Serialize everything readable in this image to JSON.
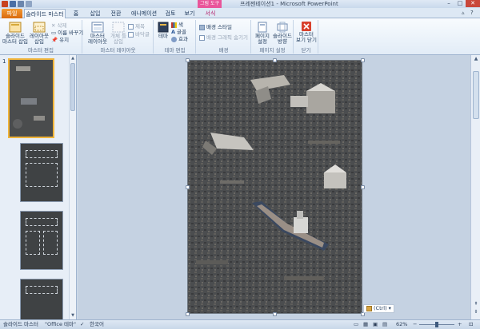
{
  "window": {
    "title": "프레젠테이션1 - Microsoft PowerPoint",
    "context_group": "그림 도구"
  },
  "tabs": [
    {
      "label": "파일",
      "kind": "file"
    },
    {
      "label": "슬라이드 마스터",
      "kind": "active"
    },
    {
      "label": "홈",
      "kind": "normal"
    },
    {
      "label": "삽입",
      "kind": "normal"
    },
    {
      "label": "전환",
      "kind": "normal"
    },
    {
      "label": "애니메이션",
      "kind": "normal"
    },
    {
      "label": "검토",
      "kind": "normal"
    },
    {
      "label": "보기",
      "kind": "normal"
    },
    {
      "label": "서식",
      "kind": "ctx"
    }
  ],
  "ribbon": {
    "master_edit": {
      "label": "마스터 편집",
      "insert_master": "슬라이드\n마스터 삽입",
      "insert_layout": "레이아웃\n삽입",
      "delete": "삭제",
      "rename": "이름 바꾸기",
      "preserve": "유지"
    },
    "master_layout": {
      "label": "마스터 레이아웃",
      "master_layout_btn": "마스터\n레이아웃",
      "insert_placeholder": "개체 틀\n삽입",
      "title": "제목",
      "footer": "바닥글"
    },
    "theme_edit": {
      "label": "테마 편집",
      "theme": "테마",
      "colors": "색",
      "fonts": "글꼴",
      "effects": "효과"
    },
    "background": {
      "label": "배경",
      "bg_styles": "배경 스타일",
      "hide_bg": "배경 그래픽 숨기기"
    },
    "page_setup": {
      "label": "페이지 설정",
      "setup": "페이지\n설정",
      "orientation": "슬라이드\n방향"
    },
    "close": {
      "label": "닫기",
      "close_master": "마스터\n보기 닫기"
    }
  },
  "thumbnails": {
    "first_number": "1"
  },
  "paste_tag": "(Ctrl)",
  "status": {
    "view": "슬라이드 마스터",
    "theme": "\"Office 테마\"",
    "language": "한국어",
    "zoom": "62%"
  },
  "colors": {
    "file_tab": "#e07a1a",
    "ribbon_bg": "#e2ecf7",
    "context_tab": "#e9559a",
    "selection_border": "#f0b43a"
  }
}
